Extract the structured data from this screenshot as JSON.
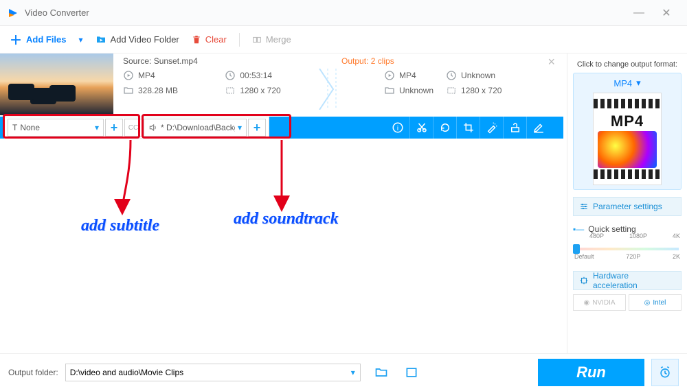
{
  "app": {
    "title": "Video Converter"
  },
  "toolbar": {
    "add_files": "Add Files",
    "add_folder": "Add Video Folder",
    "clear": "Clear",
    "merge": "Merge"
  },
  "item": {
    "source_prefix": "Source:",
    "source_file": "Sunset.mp4",
    "output_label": "Output: 2 clips",
    "src": {
      "format": "MP4",
      "duration": "00:53:14",
      "size": "328.28 MB",
      "resolution": "1280 x 720"
    },
    "out": {
      "format": "MP4",
      "duration": "Unknown",
      "size": "Unknown",
      "resolution": "1280 x 720"
    },
    "subtitle_value": "None",
    "audio_value": "* D:\\Download\\Backg",
    "cc_label": "CC"
  },
  "annotations": {
    "subtitle": "add subtitle",
    "soundtrack": "add soundtrack"
  },
  "right": {
    "header": "Click to change output format:",
    "format": "MP4",
    "param_btn": "Parameter settings",
    "quick_setting": "Quick setting",
    "ticks_top": [
      "480P",
      "1080P",
      "4K"
    ],
    "ticks_bottom": [
      "Default",
      "720P",
      "2K"
    ],
    "hw_btn": "Hardware acceleration",
    "nvidia": "NVIDIA",
    "intel": "Intel"
  },
  "bottom": {
    "label": "Output folder:",
    "path": "D:\\video and audio\\Movie Clips",
    "run": "Run"
  }
}
